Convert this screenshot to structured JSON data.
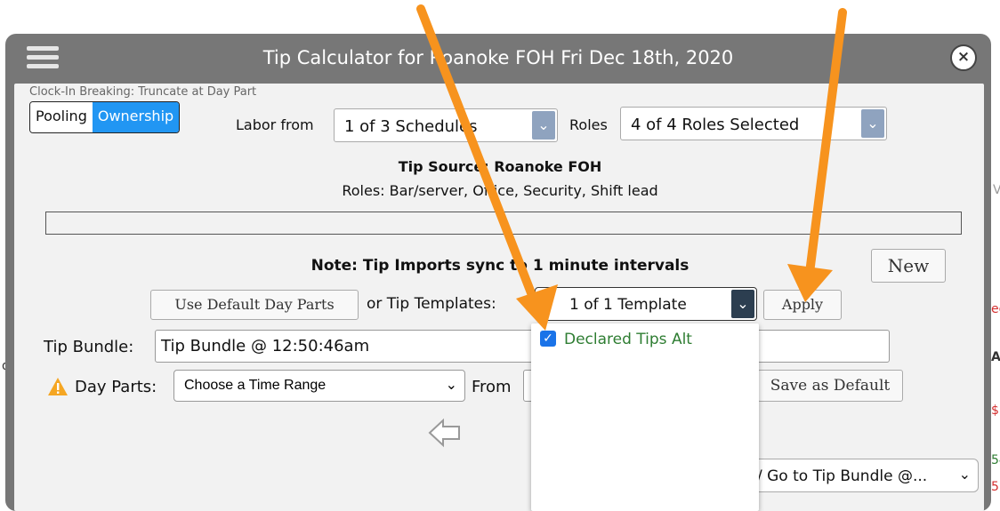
{
  "background": {
    "fragments": [
      "d",
      "V",
      "A",
      "ec",
      "$1",
      "54",
      "5."
    ]
  },
  "modal": {
    "title": "Tip Calculator for Roanoke FOH Fri Dec 18th, 2020",
    "menu_icon": "hamburger-menu-icon",
    "close_icon": "close-circle-icon",
    "close_glyph": "×",
    "clock_in_note": "Clock-In Breaking: Truncate at Day Part",
    "toggle": {
      "pooling": "Pooling",
      "ownership": "Ownership",
      "active": "Ownership"
    },
    "labor_label": "Labor from",
    "labor_value": "1 of 3 Schedules",
    "roles_label": "Roles",
    "roles_value": "4 of 4 Roles Selected",
    "tip_source": "Tip Source: Roanoke FOH",
    "roles_list": "Roles: Bar/server, Office, Security, Shift lead",
    "note": "Note: Tip Imports sync to 1 minute intervals",
    "new_button": "New",
    "default_day_parts_button": "Use Default Day Parts",
    "or_tip_templates": "or Tip Templates:",
    "templates_value": "1 of 1 Template",
    "apply_button": "Apply",
    "tip_bundle_label": "Tip Bundle:",
    "tip_bundle_value": "Tip Bundle @ 12:50:46am",
    "day_parts_label": "Day Parts:",
    "day_parts_value": "Choose a Time Range",
    "from_label": "From",
    "save_default_button": "Save as Default",
    "go_to_bundle_value": "/ Go to Tip Bundle @...",
    "dropdown_option": "Declared Tips Alt",
    "dropdown_option_checked": true
  },
  "colors": {
    "accent": "#2196f3",
    "arrow": "#f7931e",
    "option_text": "#2e7d32",
    "warning": "#f5a623"
  }
}
